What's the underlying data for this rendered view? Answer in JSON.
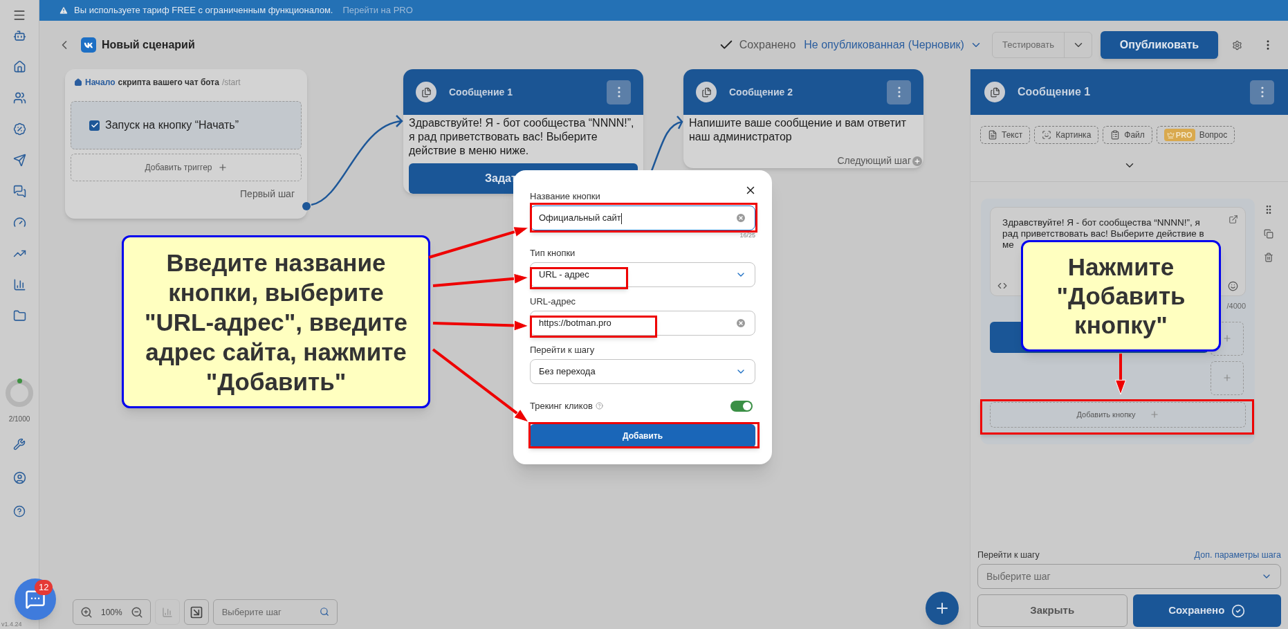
{
  "banner": {
    "text": "Вы используете тариф FREE с ограниченным функционалом.",
    "link": "Перейти на PRO"
  },
  "sidebar": {
    "usage": "2/1000",
    "version": "v1.4.24",
    "chat_badge": "12"
  },
  "header": {
    "title": "Новый сценарий",
    "save_status": "Сохранено",
    "publish_state": "Не опубликованная (Черновик)",
    "test_button": "Тестировать",
    "publish_button": "Опубликовать"
  },
  "start_node": {
    "title_link": "Начало",
    "title": "скрипта вашего чат бота",
    "command": "/start",
    "trigger": {
      "label": "Запуск на кнопку “Начать”",
      "checked": true
    },
    "add_trigger": "Добавить триггер",
    "next": "Первый шаг"
  },
  "message_nodes": [
    {
      "title": "Сообщение 1",
      "text": "Здравствуйте! Я - бот сообщества “NNNN!”, я рад приветствовать вас! Выберите действие в меню ниже.",
      "button": "Задат"
    },
    {
      "title": "Сообщение 2",
      "text": "Напишите ваше сообщение и вам ответит наш администратор",
      "next": "Следующий шаг"
    }
  ],
  "toolbar": {
    "zoom": "100%",
    "search_placeholder": "Выберите шаг"
  },
  "modal": {
    "fields": [
      {
        "kind": "input",
        "label": "Название кнопки",
        "value": "Официальный сайт",
        "counter": "16/25"
      },
      {
        "kind": "select",
        "label": "Тип кнопки",
        "value": "URL - адрес"
      },
      {
        "kind": "input",
        "label": "URL-адрес",
        "value": "https://botman.pro"
      },
      {
        "kind": "select",
        "label": "Перейти к шагу",
        "value": "Без перехода"
      }
    ],
    "tracking": {
      "label": "Трекинг кликов",
      "on": true
    },
    "submit": "Добавить"
  },
  "panel": {
    "title": "Сообщение 1",
    "content_types": [
      {
        "kind": "text",
        "label": "Текст",
        "pro": false
      },
      {
        "kind": "image",
        "label": "Картинка",
        "pro": false
      },
      {
        "kind": "file",
        "label": "Файл",
        "pro": false
      },
      {
        "kind": "question",
        "label": "Вопрос",
        "pro": true
      }
    ],
    "pro_label": "PRO",
    "message_text": "Здравствуйте! Я - бот сообщества “NNNN!”, я рад приветствовать вас! Выберите действие в ме",
    "counter": "/4000",
    "add_button": "Добавить кнопку",
    "step_label": "Перейти к шагу",
    "step_link": "Доп. параметры шага",
    "step_placeholder": "Выберите шаг",
    "close": "Закрыть",
    "save": "Сохранено"
  },
  "callouts": [
    {
      "text": "Введите название кнопки, выберите \"URL-адрес\", введите адрес сайта, нажмите \"Добавить\""
    },
    {
      "text": "Нажмите \"Добавить кнопку\""
    }
  ]
}
